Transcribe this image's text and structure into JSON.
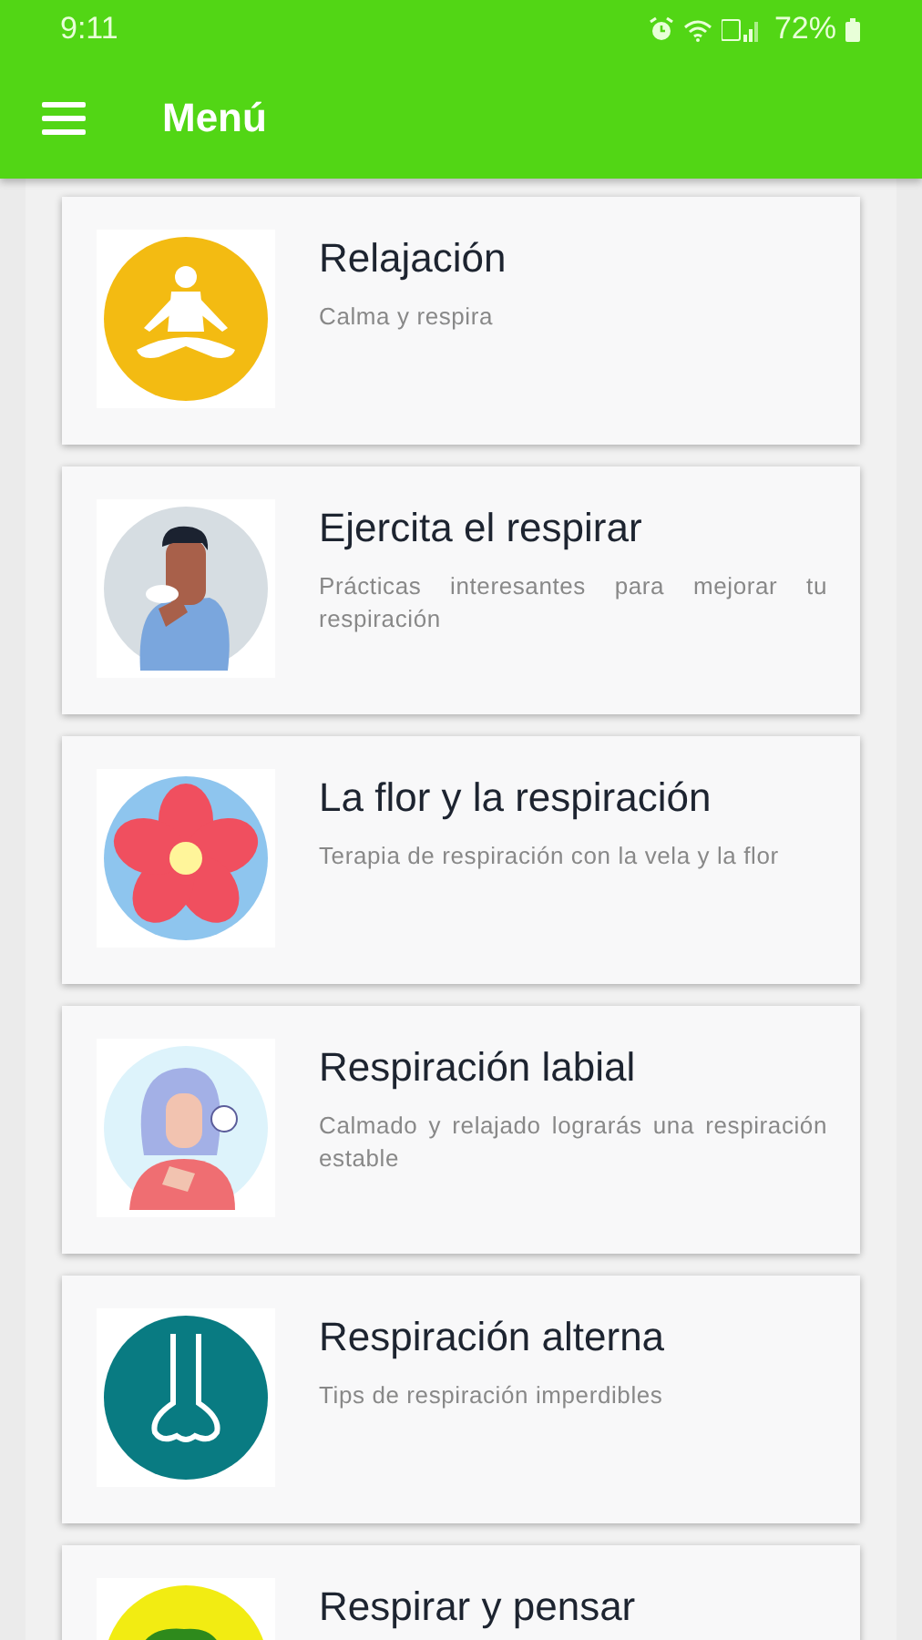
{
  "status_bar": {
    "time": "9:11",
    "battery": "72%"
  },
  "app_bar": {
    "title": "Menú"
  },
  "cards": [
    {
      "kind": "lotus",
      "title": "Relajación",
      "subtitle": "Calma y respira"
    },
    {
      "kind": "man",
      "title": "Ejercita el respirar",
      "subtitle": "Prácticas interesantes para mejorar tu respiración"
    },
    {
      "kind": "flower",
      "title": "La flor y la respiración",
      "subtitle": "Terapia de respiración con la vela y la flor"
    },
    {
      "kind": "woman",
      "title": "Respiración labial",
      "subtitle": "Calmado y relajado lograrás una respiración estable"
    },
    {
      "kind": "nose",
      "title": "Respiración alterna",
      "subtitle": "Tips de respiración imperdibles"
    },
    {
      "kind": "head",
      "title": "Respirar y pensar"
    }
  ]
}
